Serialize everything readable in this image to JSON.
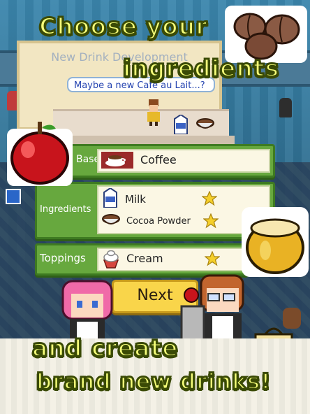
{
  "captions": {
    "line1": "Choose your",
    "line2": "ingredients",
    "line3": "and create",
    "line4": "brand new drinks!"
  },
  "dialog": {
    "title": "New Drink Development",
    "speech": "Maybe a new Cafe au Lait...?"
  },
  "base": {
    "label": "Base",
    "value": "Coffee"
  },
  "ingredients": {
    "label": "Ingredients",
    "items": [
      {
        "name": "Milk",
        "icon": "milk-carton-icon"
      },
      {
        "name": "Cocoa Powder",
        "icon": "cocoa-bowl-icon"
      }
    ]
  },
  "toppings": {
    "label": "Toppings",
    "value": "Cream",
    "icon": "cream-cup-icon"
  },
  "next_button": "Next",
  "colors": {
    "caption_fill": "#f6ff7a",
    "caption_stroke": "#3a4a05",
    "panel_green": "#67a83e",
    "star_yellow": "#f5cf2a",
    "button_yellow": "#f9d54a"
  }
}
